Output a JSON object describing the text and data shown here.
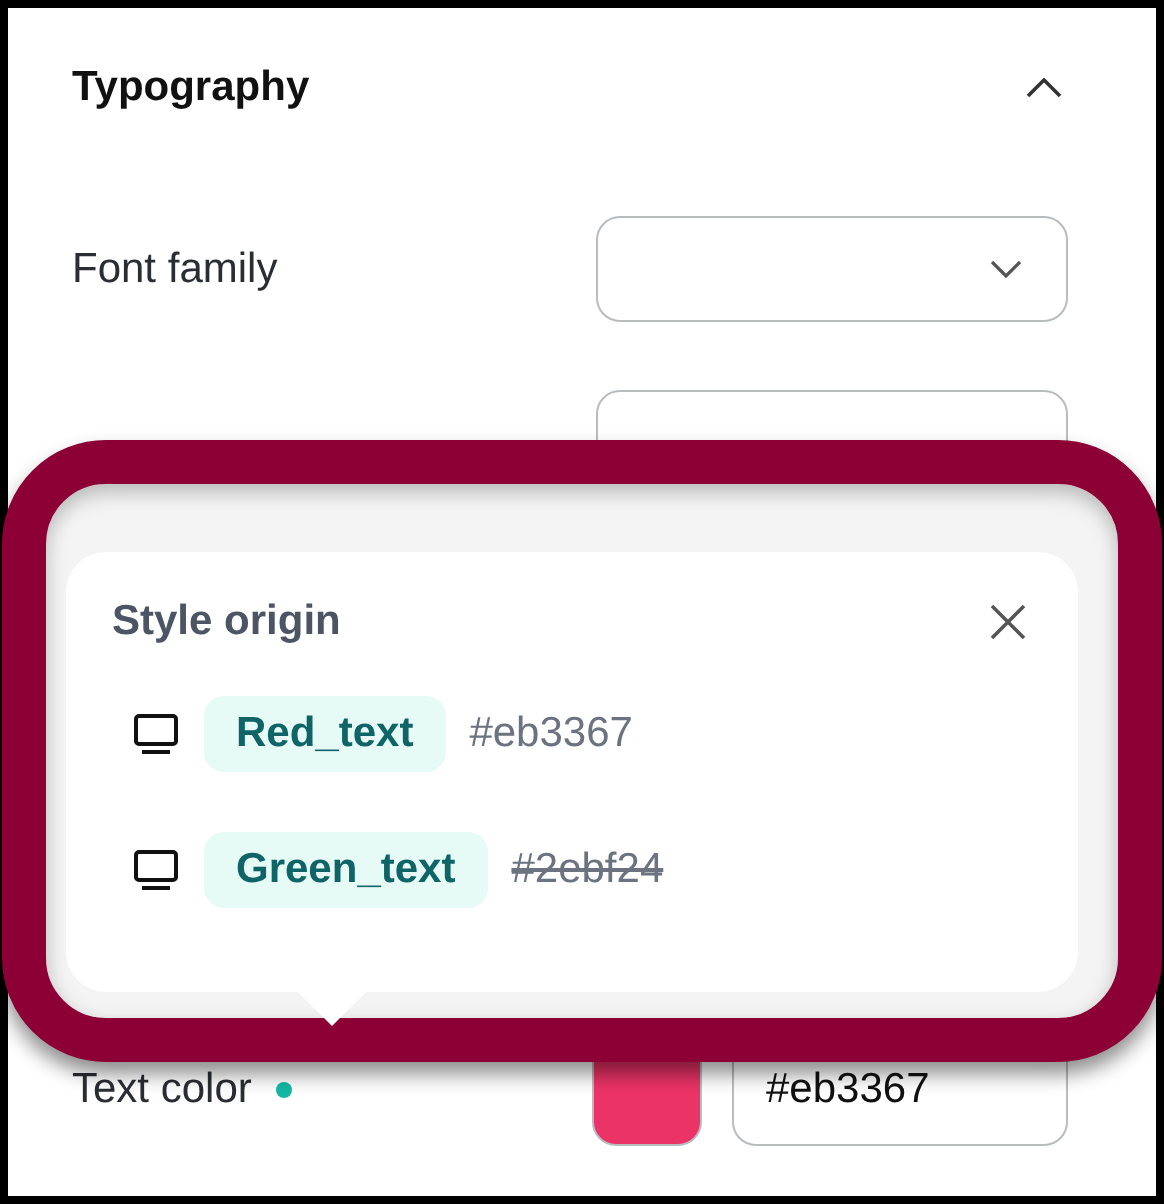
{
  "section": {
    "title": "Typography",
    "expanded": true
  },
  "font_family": {
    "label": "Font family"
  },
  "text_color": {
    "label": "Text color",
    "value": "#eb3367",
    "color": "#14b8a6"
  },
  "popover": {
    "title": "Style origin",
    "items": [
      {
        "style": "Red_text",
        "value": "#eb3367",
        "overridden": false
      },
      {
        "style": "Green_text",
        "value": "#2ebf24",
        "overridden": true
      }
    ]
  }
}
